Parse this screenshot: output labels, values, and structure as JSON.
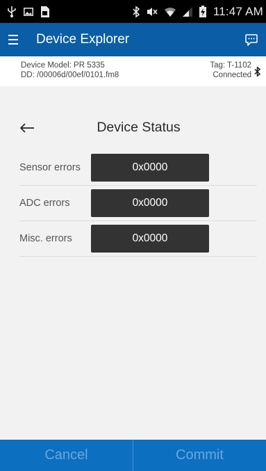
{
  "status_bar": {
    "time": "11:47 AM",
    "icons": [
      "usb-icon",
      "image-icon",
      "sim-icon",
      "bluetooth-icon",
      "mute-icon",
      "wifi-icon",
      "signal-icon",
      "battery-charging-icon"
    ]
  },
  "app_bar": {
    "title": "Device Explorer",
    "menu_icon": "hamburger-menu-icon",
    "action_icon": "chat-icon",
    "color": "#0b5da6"
  },
  "device_info": {
    "model_line": "Device Model: PR 5335",
    "dd_line": "DD: /00006d/00ef/0101.fm8",
    "tag_line": "Tag: T-1102",
    "connection": "Connected"
  },
  "page": {
    "title": "Device Status",
    "back_icon": "back-arrow-icon"
  },
  "rows": [
    {
      "label": "Sensor errors",
      "value": "0x0000"
    },
    {
      "label": "ADC errors",
      "value": "0x0000"
    },
    {
      "label": "Misc. errors",
      "value": "0x0000"
    }
  ],
  "buttons": {
    "cancel": "Cancel",
    "commit": "Commit"
  }
}
